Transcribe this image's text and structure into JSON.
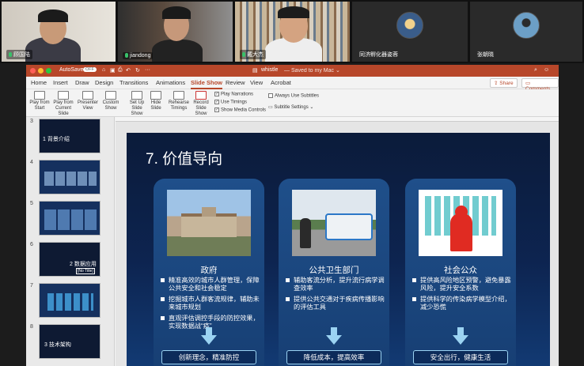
{
  "participants": [
    {
      "name": "顾国陆"
    },
    {
      "name": "jiandong"
    },
    {
      "name": "戴大杰"
    },
    {
      "name": "同济孵化器姿蓉"
    },
    {
      "name": "张朝晓"
    }
  ],
  "window": {
    "autosave_label": "AutoSave",
    "autosave_state": "OFF",
    "doc_title": "whistle",
    "saved_status": "— Saved to my Mac ⌄"
  },
  "ribbon_tabs": [
    "Home",
    "Insert",
    "Draw",
    "Design",
    "Transitions",
    "Animations",
    "Slide Show",
    "Review",
    "View",
    "Acrobat"
  ],
  "active_tab": "Slide Show",
  "share_label": "Share",
  "comments_label": "Comments",
  "ribbon": {
    "play_from_start": "Play from\nStart",
    "play_from_current": "Play from\nCurrent Slide",
    "presenter_view": "Presenter\nView",
    "custom_show": "Custom\nShow",
    "set_up_slide_show": "Set Up\nSlide Show",
    "hide_slide": "Hide\nSlide",
    "rehearse_timings": "Rehearse\nTimings",
    "record_slide_show": "Record\nSlide Show",
    "play_narrations": "Play Narrations",
    "use_timings": "Use Timings",
    "show_media_controls": "Show Media Controls",
    "always_use_subtitles": "Always Use Subtitles",
    "subtitle_settings": "Subtitle Settings"
  },
  "thumbnails": [
    {
      "num": "3",
      "caption": "1 背景介绍"
    },
    {
      "num": "4",
      "caption": ""
    },
    {
      "num": "5",
      "caption": ""
    },
    {
      "num": "6",
      "caption": "2 数据应用",
      "tag": "[No Title]"
    },
    {
      "num": "7",
      "caption": ""
    },
    {
      "num": "8",
      "caption": "3 技术架构"
    }
  ],
  "slide": {
    "title": "7. 价值导向",
    "cards": [
      {
        "title": "政府",
        "bullets": [
          "精准高效的城市人群管理，保障公共安全和社会稳定",
          "挖掘城市人群客流规律，辅助未来城市规划",
          "直观评估调控手段的防控效果，实现数据战“疫”"
        ],
        "footer": "创新理念，精准防控"
      },
      {
        "title": "公共卫生部门",
        "bullets": [
          "辅助客流分析，提升流行病学调查效率",
          "提供公共交通对于疾病传播影响的评估工具"
        ],
        "footer": "降低成本，提高效率"
      },
      {
        "title": "社会公众",
        "bullets": [
          "提供高风险地区预警，避免暴露风险，提升安全系数",
          "提供科学的传染病学模型介绍，减少恐慌"
        ],
        "footer": "安全出行，健康生活"
      }
    ]
  }
}
